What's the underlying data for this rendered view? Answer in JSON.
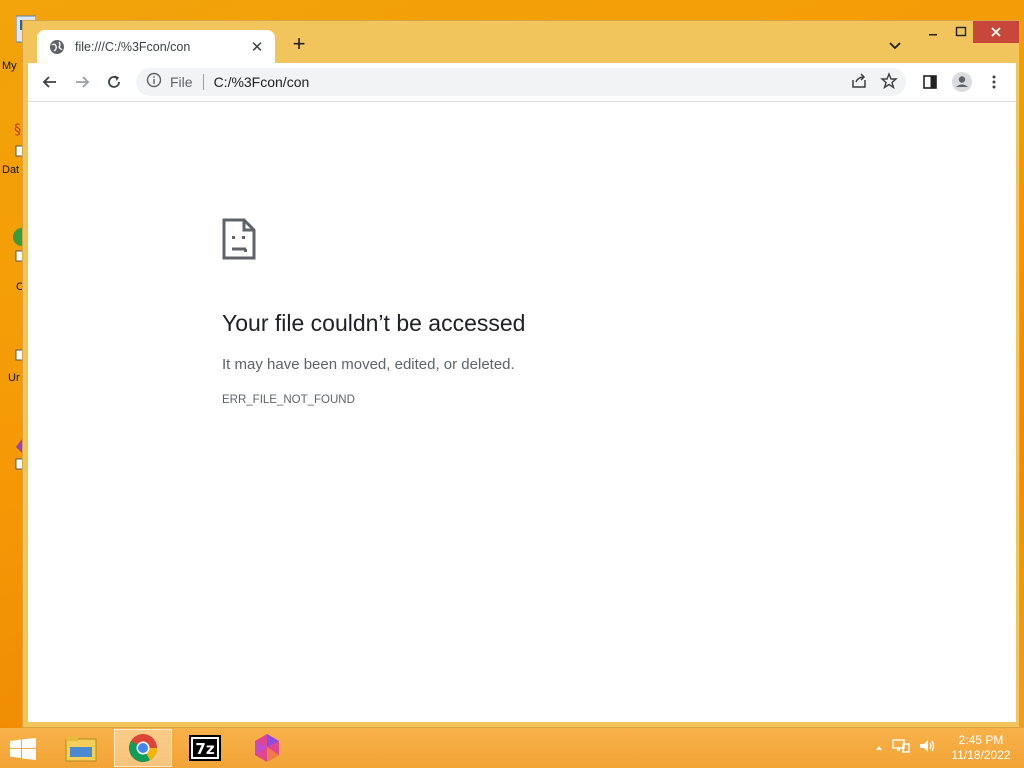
{
  "desktop": {
    "icons": [
      {
        "label": "My"
      },
      {
        "label": "Dat"
      },
      {
        "label": "C"
      },
      {
        "label": "Ur"
      },
      {
        "label": ""
      }
    ]
  },
  "browser": {
    "tab": {
      "title": "file:///C:/%3Fcon/con"
    },
    "omnibox": {
      "scheme": "File",
      "url": "C:/%3Fcon/con"
    }
  },
  "error_page": {
    "title": "Your file couldn’t be accessed",
    "subtitle": "It may have been moved, edited, or deleted.",
    "code": "ERR_FILE_NOT_FOUND"
  },
  "taskbar": {
    "apps": [
      "file-explorer",
      "chrome",
      "7-zip",
      "app-gem"
    ],
    "clock": {
      "time": "2:45 PM",
      "date": "11/18/2022"
    }
  },
  "colors": {
    "accent_close": "#c7473a",
    "window_frame": "#f1c45c",
    "desktop": "#f2a40a"
  }
}
